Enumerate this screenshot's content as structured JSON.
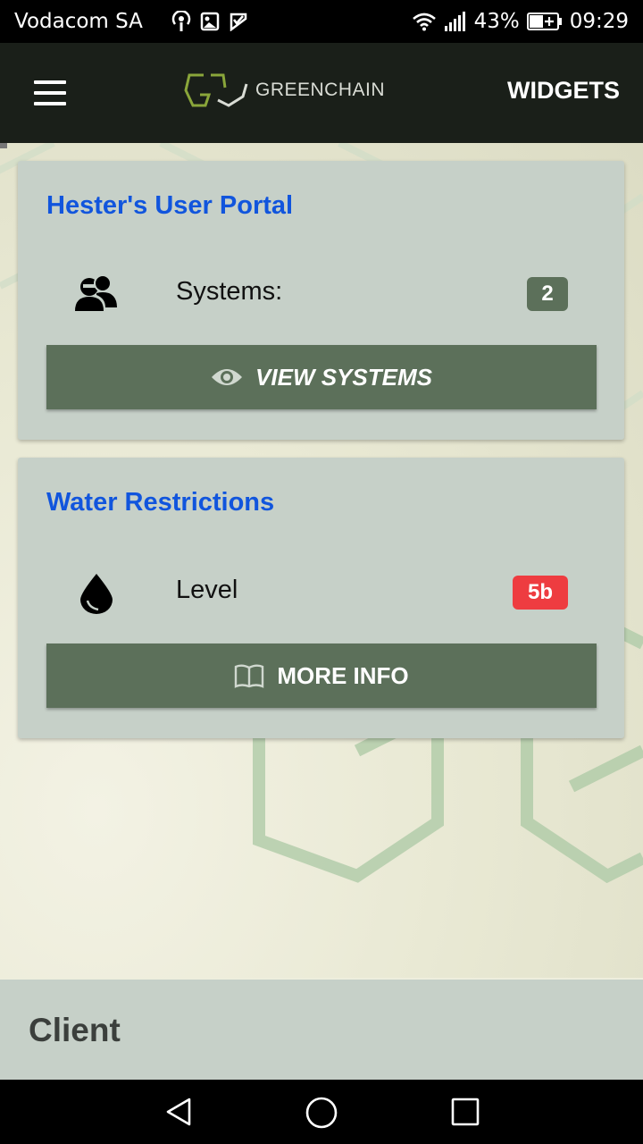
{
  "status_bar": {
    "carrier": "Vodacom SA",
    "battery_percent": "43%",
    "time": "09:29",
    "icons_left": [
      "podcast-icon",
      "gallery-icon",
      "check-flag-icon"
    ],
    "icons_right": [
      "wifi-icon",
      "signal-icon",
      "battery-icon"
    ]
  },
  "app_bar": {
    "brand_name": "GREENCHAIN",
    "menu_icon": "hamburger-menu-icon",
    "widgets_label": "WIDGETS"
  },
  "cards": [
    {
      "title": "Hester's User Portal",
      "row_icon": "users-icon",
      "row_label": "Systems:",
      "badge": "2",
      "badge_color": "#5c705a",
      "button_icon": "eye-icon",
      "button_label": "VIEW SYSTEMS"
    },
    {
      "title": "Water Restrictions",
      "row_icon": "water-drop-icon",
      "row_label": "Level",
      "badge": "5b",
      "badge_color": "#ee3c40",
      "button_icon": "book-icon",
      "button_label": "MORE INFO"
    }
  ],
  "footer": {
    "title": "Client"
  },
  "nav_bar": {
    "buttons": [
      "back-icon",
      "home-icon",
      "recents-icon"
    ]
  },
  "colors": {
    "accent_title": "#1155dd",
    "button_bg": "#5c705a",
    "card_bg": "#c6d0c8",
    "appbar_bg": "#1a1f19"
  }
}
